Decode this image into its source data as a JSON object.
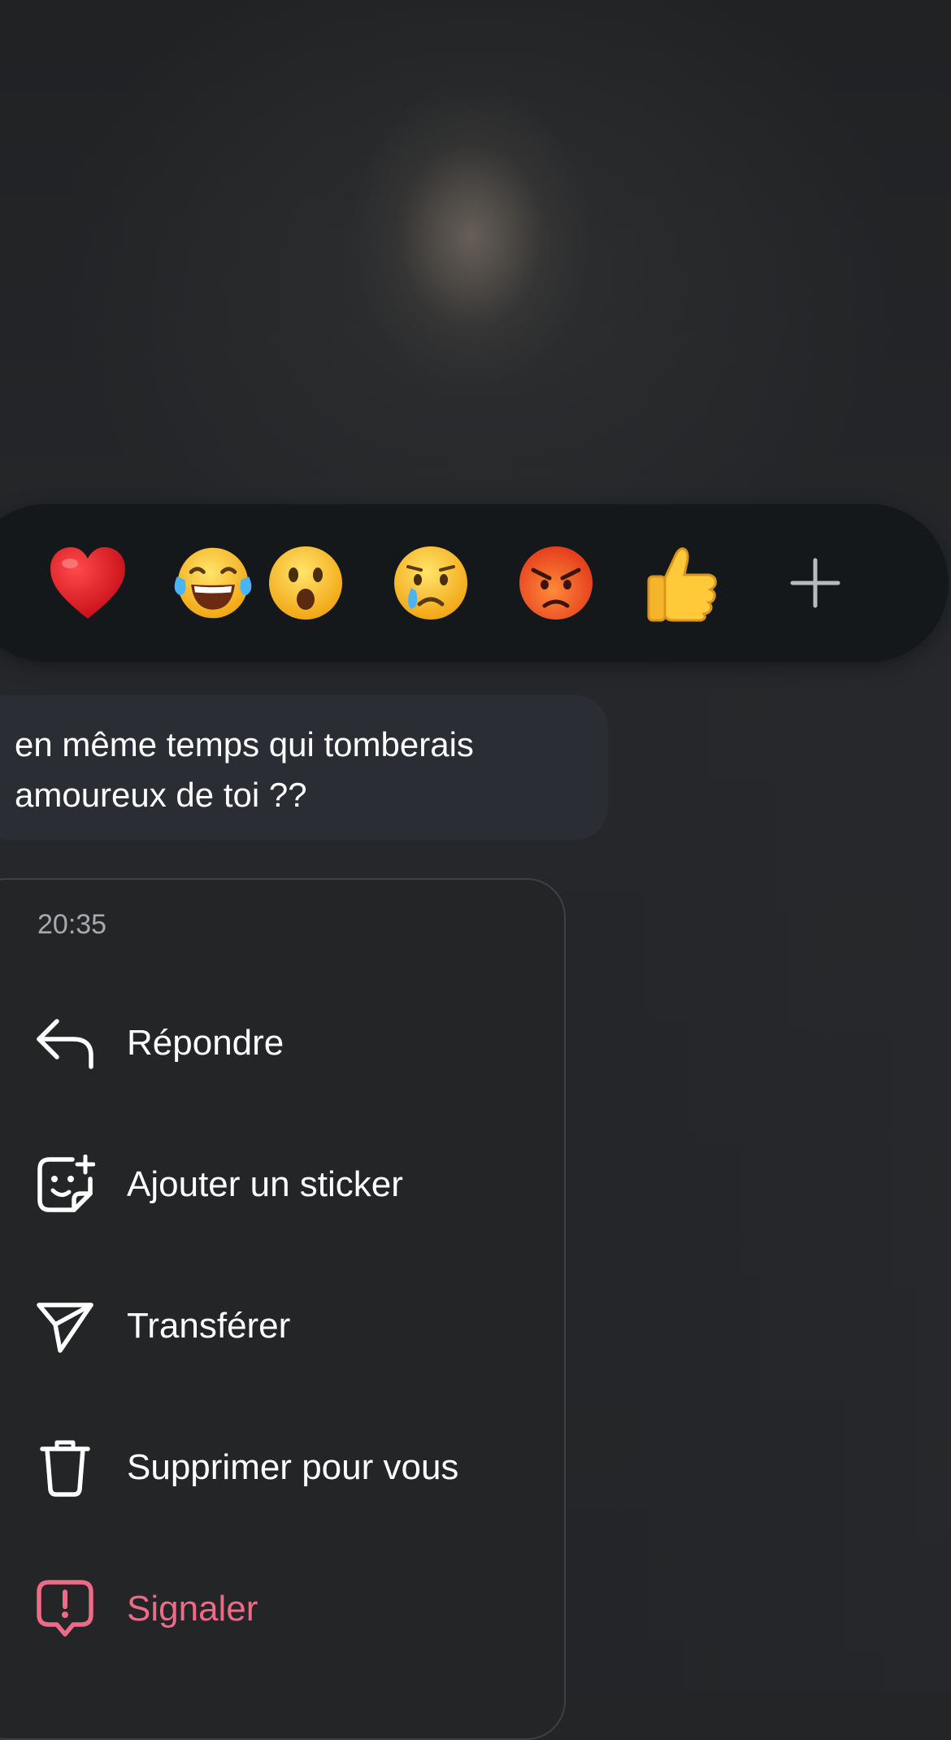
{
  "reactions": [
    {
      "icon": "red-heart-icon"
    },
    {
      "icon": "tears-of-joy-icon"
    },
    {
      "icon": "surprised-face-icon"
    },
    {
      "icon": "crying-face-icon"
    },
    {
      "icon": "angry-face-icon"
    },
    {
      "icon": "thumbs-up-icon"
    },
    {
      "icon": "plus-icon"
    }
  ],
  "message": {
    "text": "en même temps qui tomberais\namoureux de toi ??"
  },
  "menu": {
    "time": "20:35",
    "items": [
      {
        "label": "Répondre",
        "icon": "reply-arrow-icon"
      },
      {
        "label": "Ajouter un sticker",
        "icon": "sticker-icon"
      },
      {
        "label": "Transférer",
        "icon": "send-icon"
      },
      {
        "label": "Supprimer pour vous",
        "icon": "trash-icon"
      },
      {
        "label": "Signaler",
        "icon": "report-icon",
        "color": "#ee6b87"
      }
    ]
  },
  "colors": {
    "background": "#232527",
    "reaction_bar": "#15181b",
    "bubble": "#2b2d35",
    "danger": "#ee6b87"
  }
}
